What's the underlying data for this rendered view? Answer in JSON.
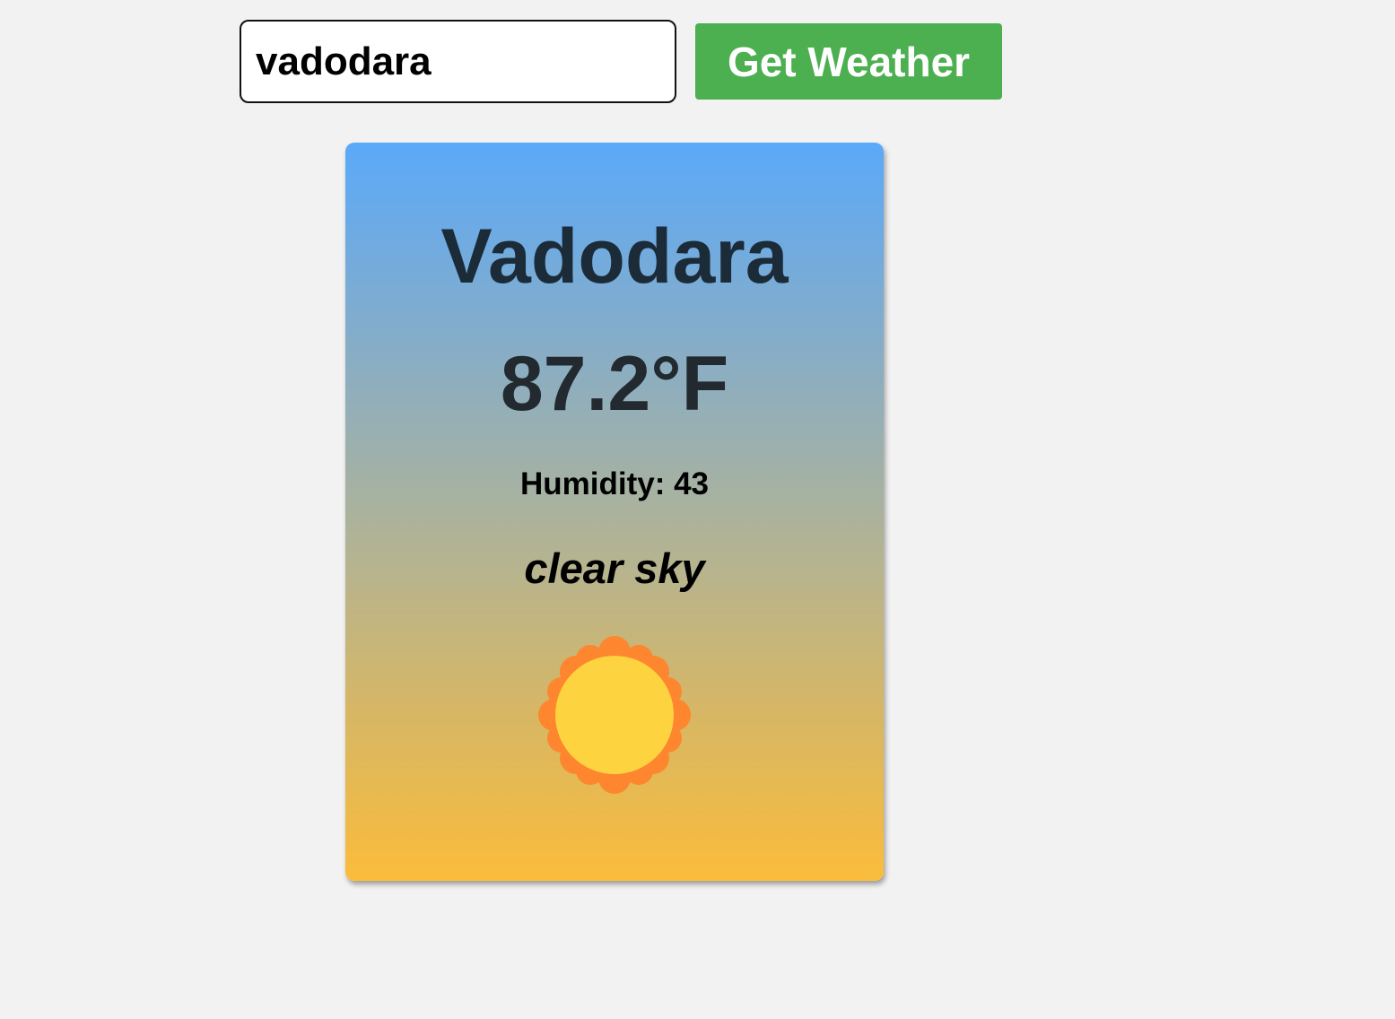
{
  "search": {
    "value": "vadodara",
    "button_label": "Get Weather"
  },
  "weather": {
    "city": "Vadodara",
    "temperature": "87.2°F",
    "humidity": "Humidity: 43",
    "description": "clear sky",
    "icon": "sun-icon"
  },
  "colors": {
    "page_background": "#f2f2f2",
    "button": "#4caf50",
    "card_top": "#5aa9fa",
    "card_bottom": "#fbbc3b",
    "sun_outer": "#fd862f",
    "sun_inner": "#fdd33f"
  }
}
